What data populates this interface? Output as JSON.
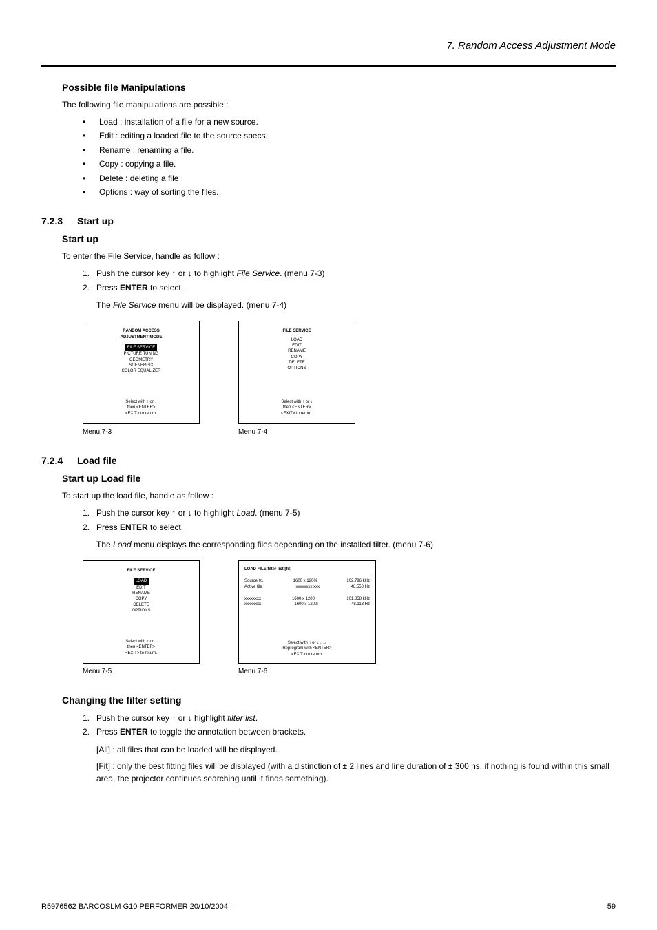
{
  "header": {
    "chapter": "7.  Random Access Adjustment Mode"
  },
  "s1": {
    "title": "Possible file Manipulations",
    "intro": "The following file manipulations are possible :",
    "bullets": [
      "Load :  installation of a file for a new source.",
      "Edit :  editing a loaded file to the source specs.",
      "Rename :  renaming a file.",
      "Copy :  copying a file.",
      "Delete :  deleting a file",
      "Options :  way of sorting the files."
    ]
  },
  "s2": {
    "num": "7.2.3",
    "title": "Start up",
    "sub_title": "Start up",
    "intro": "To enter the File Service, handle as follow :",
    "step1_a": "Push the cursor key ↑ or ↓ to highlight ",
    "step1_i": "File Service",
    "step1_b": ".  (menu 7-3)",
    "step2_a": "Press ",
    "step2_bold": "ENTER",
    "step2_b": " to select.",
    "result_a": "The ",
    "result_i": "File Service",
    "result_b": " menu will be displayed.  (menu 7-4)",
    "menu1": {
      "heading": "RANDOM ACCESS\nADJUSTMENT MODE",
      "sel": "FILE SERVICE",
      "items": "PICTURE TUNING\nGEOMETRY\nSCENERGIX\nCOLOR EQUALIZER",
      "bottom": "Select with ↑ or ↓\nthen <ENTER>\n<EXIT> to return.",
      "caption": "Menu 7-3"
    },
    "menu2": {
      "heading": "FILE SERVICE",
      "items": "LOAD\nEDIT\nRENAME\nCOPY\nDELETE\nOPTIONS",
      "bottom": "Select with ↑ or ↓\nthen <ENTER>\n<EXIT> to return.",
      "caption": "Menu 7-4"
    }
  },
  "s3": {
    "num": "7.2.4",
    "title": "Load file",
    "sub_title": "Start up Load file",
    "intro": "To start up the load file, handle as follow :",
    "step1_a": "Push the cursor key ↑ or ↓ to highlight ",
    "step1_i": "Load",
    "step1_b": ".  (menu 7-5)",
    "step2_a": "Press ",
    "step2_bold": "ENTER",
    "step2_b": " to select.",
    "result_a": "The ",
    "result_i": "Load",
    "result_b": " menu displays the corresponding files depending on the installed filter.  (menu 7-6)",
    "menu1": {
      "heading": "FILE SERVICE",
      "sel": "LOAD",
      "items": "EDIT\nRENAME\nCOPY\nDELETE\nOPTIONS",
      "bottom": "Select with ↑ or ↓\nthen <ENTER>\n<EXIT> to return.",
      "caption": "Menu 7-5"
    },
    "menu2": {
      "heading": "LOAD FILE      filter list [fit]",
      "rows": [
        [
          "Source 01",
          "1600 x 1200i",
          "102.796 kHz"
        ],
        [
          "Active file :",
          "xxxxxxxx.xxx",
          "48.550 Hz"
        ],
        [
          "xxxxxxxx",
          "1600 x 1200i",
          "101.858 kHz"
        ],
        [
          "xxxxxxxx",
          "1600 x 1200i",
          "48.113 Hz"
        ]
      ],
      "bottom": "Select with ↑ or ↓ , →\nReprogram with <ENTER>\n<EXIT> to return.",
      "caption": "Menu 7-6"
    }
  },
  "s4": {
    "title": "Changing the filter setting",
    "step1_a": "Push the cursor key ↑ or ↓ highlight ",
    "step1_i": "filter list",
    "step1_b": ".",
    "step2_a": "Press ",
    "step2_bold": "ENTER",
    "step2_b": " to toggle the annotation between brackets.",
    "all": "[All] :  all files that can be loaded will be displayed.",
    "fit": "[Fit] :  only the best fitting files will be displayed (with a distinction of ± 2 lines and line duration of ± 300 ns, if nothing is found within this small area, the projector continues searching until it finds something)."
  },
  "footer": {
    "left": "R5976562   BARCOSLM G10 PERFORMER   20/10/2004",
    "page": "59"
  }
}
